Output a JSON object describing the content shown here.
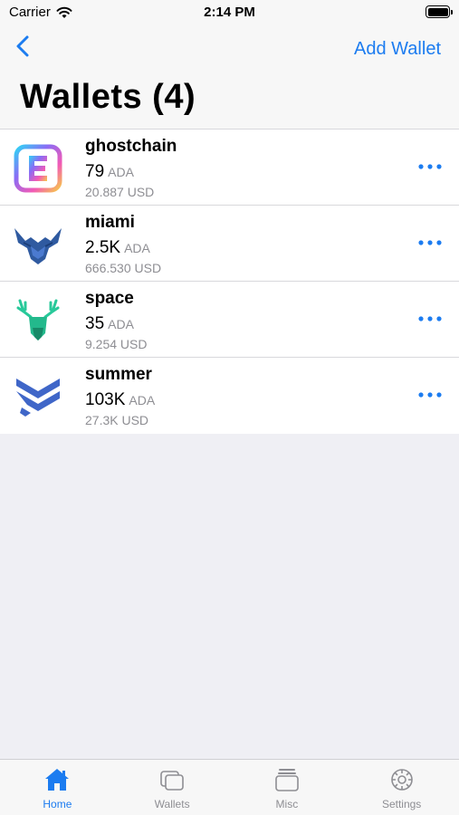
{
  "status": {
    "carrier": "Carrier",
    "time": "2:14 PM"
  },
  "nav": {
    "add_wallet": "Add Wallet",
    "title": "Wallets (4)"
  },
  "wallets": [
    {
      "name": "ghostchain",
      "amount": "79",
      "unit": "ADA",
      "fiat": "20.887 USD"
    },
    {
      "name": "miami",
      "amount": "2.5K",
      "unit": "ADA",
      "fiat": "666.530 USD"
    },
    {
      "name": "space",
      "amount": "35",
      "unit": "ADA",
      "fiat": "9.254 USD"
    },
    {
      "name": "summer",
      "amount": "103K",
      "unit": "ADA",
      "fiat": "27.3K USD"
    }
  ],
  "tabs": [
    {
      "label": "Home",
      "icon": "home-icon",
      "active": true
    },
    {
      "label": "Wallets",
      "icon": "wallets-icon",
      "active": false
    },
    {
      "label": "Misc",
      "icon": "misc-icon",
      "active": false
    },
    {
      "label": "Settings",
      "icon": "settings-icon",
      "active": false
    }
  ],
  "colors": {
    "accent": "#1c7cf0",
    "secondary_text": "#8e8e93"
  }
}
